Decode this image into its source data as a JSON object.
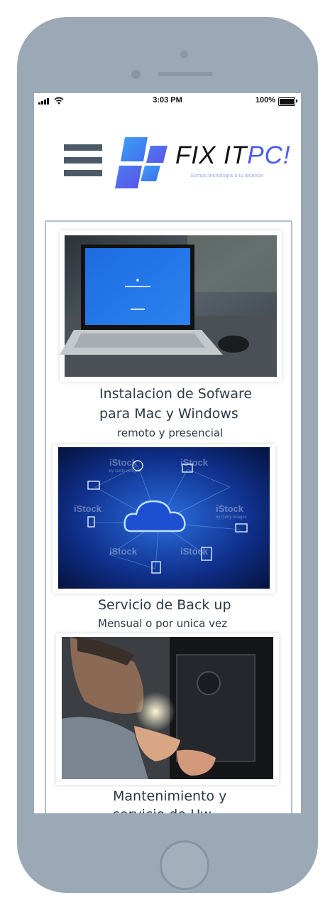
{
  "status_bar": {
    "time": "3:03 PM",
    "battery": "100%"
  },
  "header": {
    "logo_text_dark": "FIX IT",
    "logo_text_accent": "PC!",
    "tagline": "Somos tecnología a tu alcance",
    "menu_icon": "hamburger-menu-icon"
  },
  "services": [
    {
      "title_line1": "Instalacion de Sofware",
      "title_line2": "para Mac y Windows",
      "subtitle": "remoto y presencial",
      "image": "laptop-photo"
    },
    {
      "title_line1": "Servicio de Back up",
      "subtitle": "Mensual o por unica vez",
      "image": "cloud-network-photo",
      "watermark": "iStock",
      "watermark_sub": "by Getty Images"
    },
    {
      "title_line1": "Mantenimiento y",
      "title_line2": "servicio de Hw",
      "image": "technician-photo"
    }
  ],
  "colors": {
    "accent": "#4a5bf0",
    "frame": "#9ba8b5",
    "text": "#2c3a47"
  }
}
